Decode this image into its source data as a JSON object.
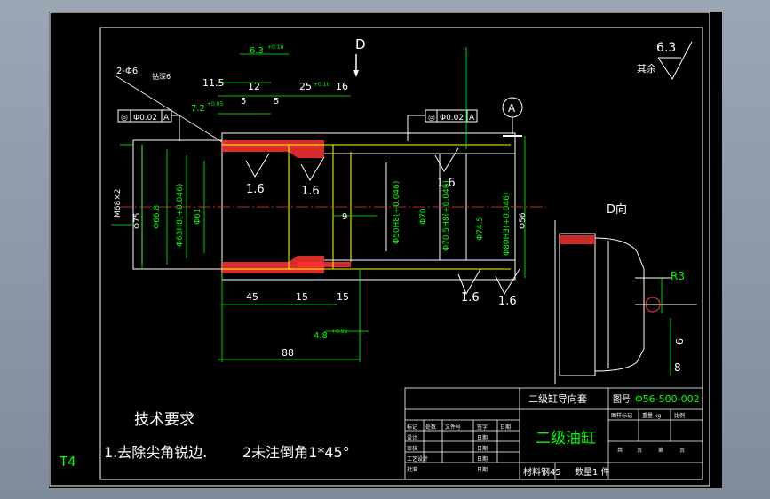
{
  "colors": {
    "frame": "#ffffff",
    "dim": "#00ff00",
    "outline": "#ffffff",
    "section": "#ff3333",
    "yellow": "#ffff00",
    "center": "#ff3333",
    "tag": "#00ff00",
    "bg": "#000000"
  },
  "sheet_tag": "T4",
  "view_labels": {
    "section_d": "D",
    "view_d": "D向",
    "datum_a": "A"
  },
  "surface_finish": {
    "general_value": "6.3",
    "general_note": "其余",
    "values": [
      "1.6",
      "1.6",
      "1.6",
      "1.6",
      "1.6"
    ]
  },
  "tolerance_frames": [
    {
      "symbol": "◎",
      "value": "Φ0.02",
      "datum": "A"
    },
    {
      "symbol": "◎",
      "value": "Φ0.02",
      "datum": "A"
    }
  ],
  "callouts": {
    "holes": "2-Φ6",
    "drill": "钻深6"
  },
  "dimensions": {
    "top": [
      "6.3",
      "11.5",
      "12",
      "7.2",
      "5",
      "25",
      "16",
      "5"
    ],
    "right_vertical": [
      "Φ56"
    ],
    "left_vertical": [
      "M68×2",
      "Φ75",
      "Φ66.8",
      "Φ63H8(+0.046)",
      "Φ61"
    ],
    "bore_vertical": [
      "Φ50H8(+0.046)",
      "Φ70",
      "Φ70.5H8(+0.046)",
      "Φ74.5",
      "Φ80H3(+0.046)"
    ],
    "bottom": [
      "45",
      "15",
      "15",
      "88",
      "4.8"
    ],
    "inner": "9",
    "detail": [
      "R3",
      "6",
      "8"
    ],
    "tolerance_sup": [
      "+0.10",
      "+0.05",
      "+0.10",
      "+0.05",
      "+0.10",
      "+0.10",
      "+0.05",
      "+0.10"
    ]
  },
  "notes": {
    "title": "技术要求",
    "line1": "1.去除尖角锐边.",
    "line2": "2未注倒角1*45°"
  },
  "title_block": {
    "part_name": "二级缸导向套",
    "drawing_no_label": "图号",
    "drawing_no": "Φ56-500-002",
    "assembly": "二级油缸",
    "material_label": "材料",
    "material": "钢45",
    "quantity_label": "数量",
    "quantity": "1 件",
    "row_headers": [
      "标记",
      "处数",
      "文件号",
      "签字",
      "日期"
    ],
    "roles": [
      "设计",
      "审核",
      "工艺设计",
      "批准"
    ],
    "date_word": "日期",
    "right_headers": [
      "图样标记",
      "重量 kg",
      "比例"
    ],
    "sheet_row": [
      "共",
      "页",
      "第",
      "页"
    ]
  }
}
